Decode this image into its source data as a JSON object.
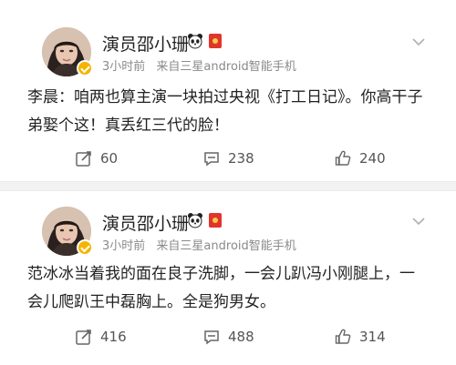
{
  "posts": [
    {
      "user": {
        "name": "演员邵小珊",
        "avatar_icon": "user-avatar",
        "verified_icon": "verified-badge-icon",
        "badge_icons": [
          "panda-icon",
          "red-envelope-icon"
        ]
      },
      "meta": {
        "time": "3小时前",
        "source": "来自三星android智能手机"
      },
      "content": "李晨：咱两也算主演一块拍过央视《打工日记》。你高干子弟娶个这！真丢红三代的脸！",
      "actions": {
        "repost": "60",
        "comment": "238",
        "like": "240"
      }
    },
    {
      "user": {
        "name": "演员邵小珊",
        "avatar_icon": "user-avatar",
        "verified_icon": "verified-badge-icon",
        "badge_icons": [
          "panda-icon",
          "red-envelope-icon"
        ]
      },
      "meta": {
        "time": "3小时前",
        "source": "来自三星android智能手机"
      },
      "content": "范冰冰当着我的面在良子洗脚，一会儿趴冯小刚腿上，一会儿爬趴王中磊胸上。全是狗男女。",
      "actions": {
        "repost": "416",
        "comment": "488",
        "like": "314"
      }
    }
  ],
  "colors": {
    "text": "#222222",
    "meta": "#8a8a8a",
    "action": "#555555",
    "verified": "#f5b400",
    "red_envelope": "#e0352b",
    "divider": "#f2f2f2"
  }
}
